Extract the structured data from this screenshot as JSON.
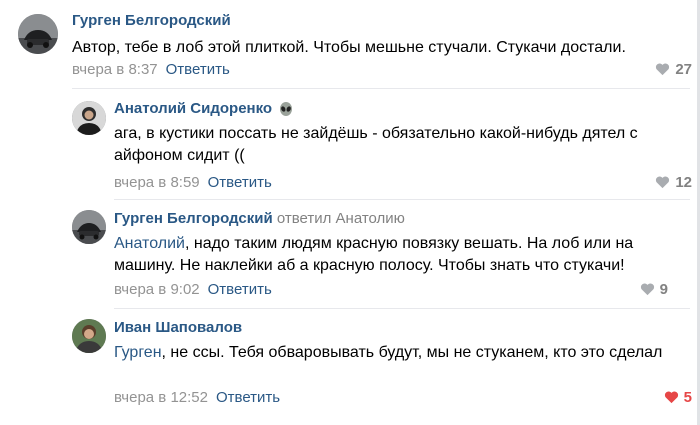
{
  "comments": [
    {
      "author": "Гурген Белгородский",
      "text": "Автор, тебе в лоб этой плиткой. Чтобы мешьне стучали. Стукачи достали.",
      "time": "вчера в 8:37",
      "reply_label": "Ответить",
      "likes": "27",
      "liked": false
    },
    {
      "author": "Анатолий Сидоренко",
      "author_emoji": "alien-emoji",
      "text": "ага, в кустики поссать не зайдёшь - обязательно какой-нибудь дятел с айфоном сидит ((",
      "time": "вчера в 8:59",
      "reply_label": "Ответить",
      "likes": "12",
      "liked": false
    },
    {
      "author": "Гурген Белгородский",
      "replied_to": "ответил Анатолию",
      "mention": "Анатолий",
      "text": ", надо таким людям красную повязку вешать. На лоб или на машину. Не наклейки аб а красную полосу. Чтобы знать что стукачи!",
      "time": "вчера в 9:02",
      "reply_label": "Ответить",
      "likes": "9",
      "liked": false
    },
    {
      "author": "Иван Шаповалов",
      "mention": "Гурген",
      "text": ", не ссы. Тебя обваровывать будут, мы не стуканем, кто это сделал",
      "time": "вчера в 12:52",
      "reply_label": "Ответить",
      "likes": "5",
      "liked": true
    }
  ],
  "colors": {
    "link": "#2a5885",
    "meta": "#939393",
    "like_inactive": "#828282",
    "like_active": "#e64646",
    "divider": "#e7e8ec"
  }
}
